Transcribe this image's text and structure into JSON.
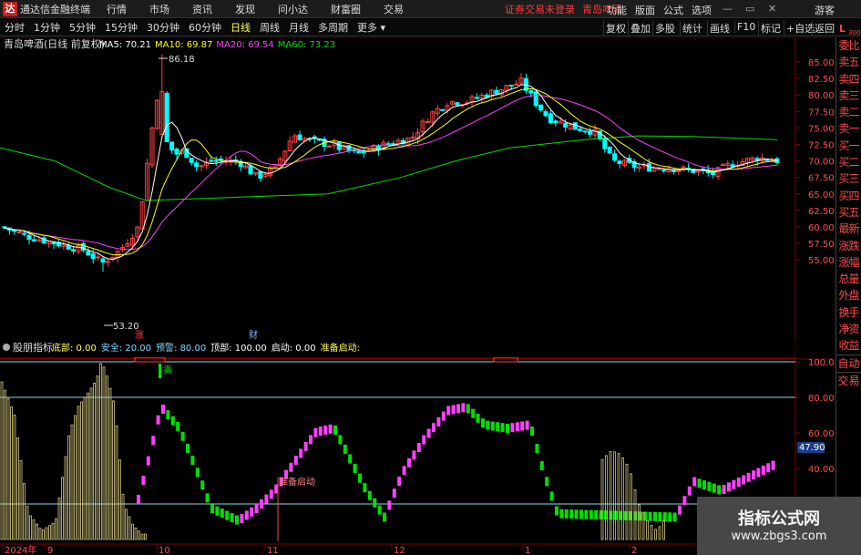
{
  "menubar": {
    "title": "通达信金融终端",
    "items": [
      "行情",
      "市场",
      "资讯",
      "发现",
      "问小达",
      "财富圈",
      "交易"
    ],
    "login": "证券交易未登录",
    "stock": "青岛啤酒",
    "right": [
      "功能",
      "版面",
      "公式",
      "选项"
    ],
    "guest": "游客"
  },
  "toolbar": {
    "periods": [
      "分时",
      "1分钟",
      "5分钟",
      "15分钟",
      "30分钟",
      "60分钟",
      "日线",
      "周线",
      "月线",
      "多周期",
      "更多 ▾"
    ],
    "active": "日线",
    "right": [
      "复权",
      "叠加",
      "多股",
      "统计",
      "画线",
      "F10",
      "标记",
      "+自选",
      "返回"
    ]
  },
  "main": {
    "title": "青岛啤酒(日线 前复权)",
    "ma": [
      {
        "label": "MA5: 70.21",
        "color": "#ffffff"
      },
      {
        "label": "MA10: 69.87",
        "color": "#ffff00"
      },
      {
        "label": "MA20: 69.54",
        "color": "#ff40ff"
      },
      {
        "label": "MA60: 73.23",
        "color": "#00e000"
      }
    ],
    "high_label": "86.18",
    "low_label": "53.20",
    "marker_zhang": "涨",
    "marker_cai": "财",
    "yticks": [
      "85.00",
      "82.50",
      "80.00",
      "77.50",
      "75.00",
      "72.50",
      "70.00",
      "67.50",
      "65.00",
      "62.50",
      "60.00",
      "57.50",
      "55.00"
    ]
  },
  "sub": {
    "title": "股朋指标",
    "params": [
      {
        "label": "底部: 0.00",
        "color": "#ffff54"
      },
      {
        "label": "安全: 20.00",
        "color": "#7fd7ff"
      },
      {
        "label": "预警: 80.00",
        "color": "#7fd7ff"
      },
      {
        "label": "顶部: 100.00",
        "color": "#ffffff"
      },
      {
        "label": "启动: 0.00",
        "color": "#ffffff"
      },
      {
        "label": "准备启动:",
        "color": "#ffff54"
      }
    ],
    "yticks": [
      "100.0",
      "80.00",
      "60.00",
      "40.00"
    ],
    "current": "47.90",
    "sell_label": "卖",
    "start_label": "准备启动",
    "dates": [
      "2024年",
      "9",
      "10",
      "11",
      "12",
      "1",
      "2"
    ]
  },
  "sidebar": [
    "委比",
    "卖五",
    "卖四",
    "卖三",
    "卖二",
    "卖一",
    "买一",
    "买二",
    "买三",
    "买四",
    "买五",
    "最新",
    "涨跌",
    "涨幅",
    "总量",
    "外盘",
    "换手",
    "净资",
    "收益"
  ],
  "sidebar2": [
    "自动",
    "交易"
  ],
  "watermark": {
    "line1": "指标公式网",
    "line2": "www.zbgs3.com"
  },
  "chip": {
    "label": "L",
    "sub": "300"
  },
  "chart_data": {
    "type": "candlestick",
    "title": "青岛啤酒(日线 前复权)",
    "x": [
      "2024-08",
      "2024-09",
      "2024-10",
      "2024-11",
      "2024-12",
      "2025-01",
      "2025-02"
    ],
    "y_range": [
      54,
      87
    ],
    "high": 86.18,
    "low": 53.2,
    "ma": {
      "MA5": 70.21,
      "MA10": 69.87,
      "MA20": 69.54,
      "MA60": 73.23
    },
    "indicator": {
      "name": "股朋指标",
      "levels": {
        "底部": 0,
        "安全": 20,
        "预警": 80,
        "顶部": 100
      },
      "current": 47.9
    }
  },
  "colors": {
    "up": "#ff4040",
    "down": "#00ffff",
    "ma5": "#ffffff",
    "ma10": "#ffff00",
    "ma20": "#ff40ff",
    "ma60": "#00e000",
    "grid": "#800000"
  }
}
